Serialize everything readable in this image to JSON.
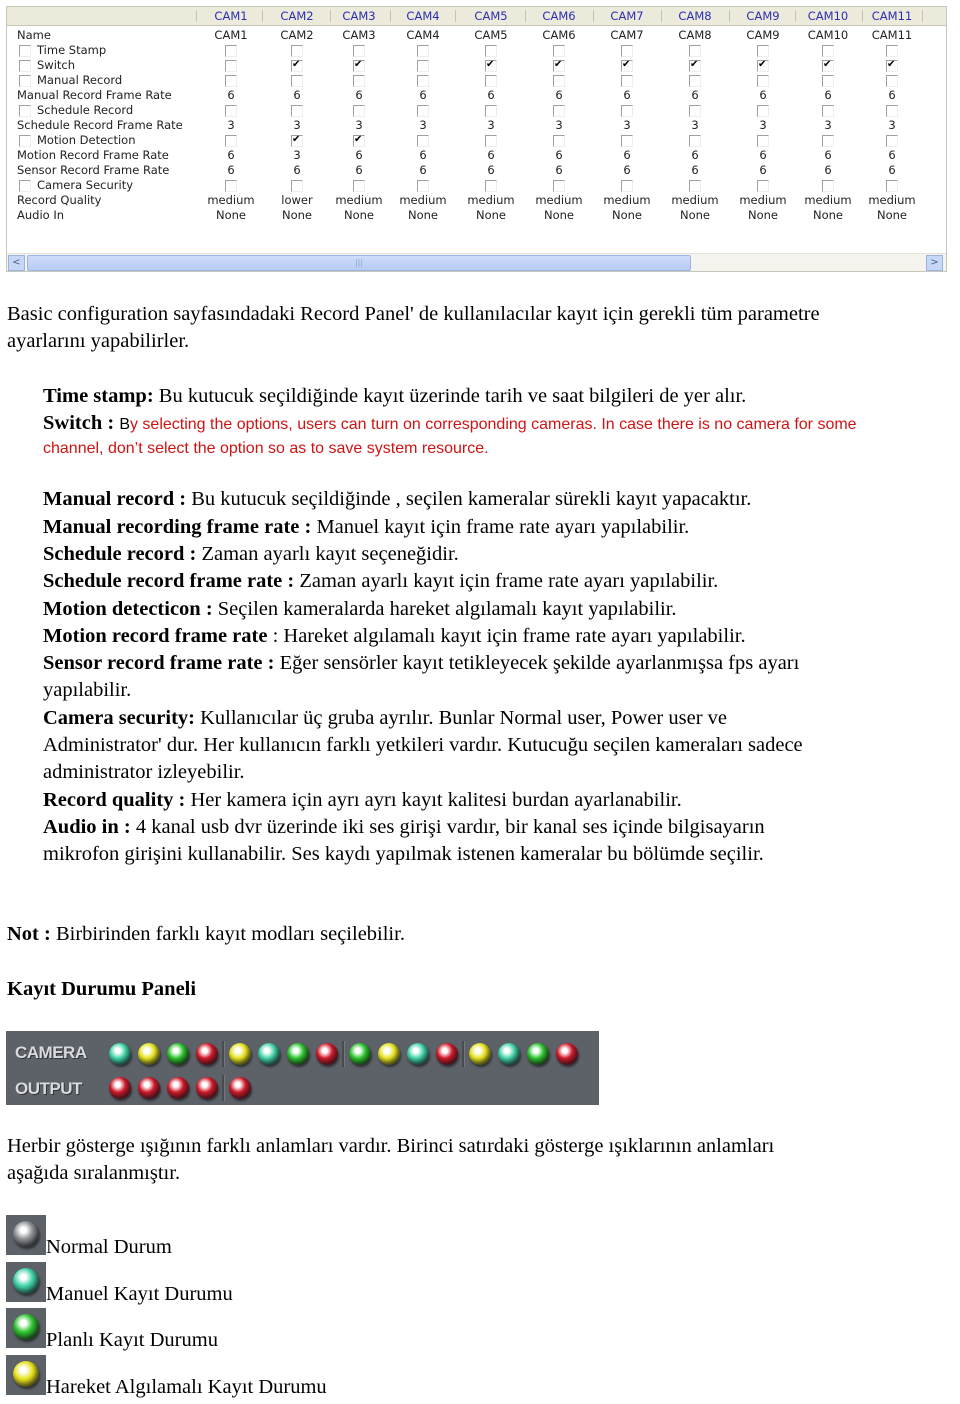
{
  "panel": {
    "columns": [
      "CAM1",
      "CAM2",
      "CAM3",
      "CAM4",
      "CAM5",
      "CAM6",
      "CAM7",
      "CAM8",
      "CAM9",
      "CAM10",
      "CAM11"
    ],
    "rows": [
      {
        "label": "Name",
        "type": "text",
        "has_checkbox": false,
        "values": [
          "CAM1",
          "CAM2",
          "CAM3",
          "CAM4",
          "CAM5",
          "CAM6",
          "CAM7",
          "CAM8",
          "CAM9",
          "CAM10",
          "CAM11"
        ]
      },
      {
        "label": "Time Stamp",
        "type": "check",
        "has_checkbox": true,
        "values": [
          false,
          false,
          false,
          false,
          false,
          false,
          false,
          false,
          false,
          false,
          false
        ]
      },
      {
        "label": "Switch",
        "type": "check",
        "has_checkbox": true,
        "values": [
          false,
          true,
          true,
          false,
          true,
          true,
          true,
          true,
          true,
          true,
          true
        ]
      },
      {
        "label": "Manual Record",
        "type": "check",
        "has_checkbox": true,
        "values": [
          false,
          false,
          false,
          false,
          false,
          false,
          false,
          false,
          false,
          false,
          false
        ]
      },
      {
        "label": "Manual Record Frame Rate",
        "type": "text",
        "has_checkbox": false,
        "values": [
          "6",
          "6",
          "6",
          "6",
          "6",
          "6",
          "6",
          "6",
          "6",
          "6",
          "6"
        ]
      },
      {
        "label": "Schedule Record",
        "type": "check",
        "has_checkbox": true,
        "values": [
          false,
          false,
          false,
          false,
          false,
          false,
          false,
          false,
          false,
          false,
          false
        ]
      },
      {
        "label": "Schedule Record Frame Rate",
        "type": "text",
        "has_checkbox": false,
        "values": [
          "3",
          "3",
          "3",
          "3",
          "3",
          "3",
          "3",
          "3",
          "3",
          "3",
          "3"
        ]
      },
      {
        "label": "Motion Detection",
        "type": "check",
        "has_checkbox": true,
        "values": [
          false,
          true,
          true,
          false,
          false,
          false,
          false,
          false,
          false,
          false,
          false
        ]
      },
      {
        "label": "Motion Record Frame Rate",
        "type": "text",
        "has_checkbox": false,
        "values": [
          "6",
          "3",
          "6",
          "6",
          "6",
          "6",
          "6",
          "6",
          "6",
          "6",
          "6"
        ]
      },
      {
        "label": "Sensor Record Frame Rate",
        "type": "text",
        "has_checkbox": false,
        "values": [
          "6",
          "6",
          "6",
          "6",
          "6",
          "6",
          "6",
          "6",
          "6",
          "6",
          "6"
        ]
      },
      {
        "label": "Camera Security",
        "type": "check",
        "has_checkbox": true,
        "values": [
          false,
          false,
          false,
          false,
          false,
          false,
          false,
          false,
          false,
          false,
          false
        ]
      },
      {
        "label": "Record Quality",
        "type": "text",
        "has_checkbox": false,
        "values": [
          "medium",
          "lower",
          "medium",
          "medium",
          "medium",
          "medium",
          "medium",
          "medium",
          "medium",
          "medium",
          "medium"
        ]
      },
      {
        "label": "Audio In",
        "type": "text",
        "has_checkbox": false,
        "values": [
          "None",
          "None",
          "None",
          "None",
          "None",
          "None",
          "None",
          "None",
          "None",
          "None",
          "None"
        ]
      }
    ],
    "scroll_left": "<",
    "scroll_right": ">"
  },
  "intro": {
    "line1": "Basic configuration   sayfasındadaki Record Panel' de kullanılacılar kayıt için gerekli tüm parametre",
    "line2": "ayarlarını yapabilirler."
  },
  "items": [
    {
      "term": "Time stamp:",
      "desc": " Bu kutucuk seçildiğinde kayıt üzerinde tarih ve saat  bilgileri de yer alır."
    },
    {
      "term": "Switch : ",
      "desc_black": "B",
      "desc_red1": "y selecting the options, users can turn on corresponding cameras. In case there is no camera for some",
      "desc_red2": "channel, don’t select the option so as to save system resource."
    },
    {
      "term": "Manual record : ",
      "desc": "Bu kutucuk seçildiğinde , seçilen kameralar  sürekli kayıt yapacaktır."
    },
    {
      "term": "Manual recording frame rate : ",
      "desc": "Manuel kayıt için frame rate ayarı yapılabilir."
    },
    {
      "term": "Schedule record : ",
      "desc": "Zaman ayarlı kayıt seçeneğidir."
    },
    {
      "term": "Schedule record frame rate : ",
      "desc": "Zaman ayarlı kayıt için frame rate ayarı yapılabilir."
    },
    {
      "term": "Motion detecticon : ",
      "desc": " Seçilen kameralarda hareket algılamalı kayıt yapılabilir."
    },
    {
      "term": "Motion record frame rate ",
      "desc": "  : Hareket algılamalı kayıt için frame rate ayarı yapılabilir."
    },
    {
      "term": "Sensor record frame rate : ",
      "desc": "Eğer sensörler kayıt tetikleyecek şekilde ayarlanmışsa fps ayarı",
      "desc2": "yapılabilir."
    },
    {
      "term": "Camera security: ",
      "desc": "Kullanıcılar üç gruba ayrılır. Bunlar Normal user,  Power user ve",
      "desc2": "Administrator' dur. Her kullanıcın farklı yetkileri vardır.  Kutucuğu seçilen kameraları sadece",
      "desc3": "administrator izleyebilir."
    },
    {
      "term": "Record quality : ",
      "desc": " Her kamera için ayrı ayrı kayıt kalitesi burdan ayarlanabilir."
    },
    {
      "term": "Audio in : ",
      "desc": "4 kanal usb dvr  üzerinde iki ses girişi vardır, bir kanal ses içinde bilgisayarın",
      "desc2": "mikrofon girişini kullanabilir. Ses kaydı yapılmak istenen kameralar bu bölümde seçilir."
    }
  ],
  "note": {
    "term": "Not : ",
    "desc": "Birbirinden farklı kayıt modları seçilebilir."
  },
  "status_heading": "Kayıt Durumu Paneli",
  "status_panel": {
    "camera_label": "CAMERA",
    "output_label": "OUTPUT",
    "camera_leds": [
      "teal",
      "yellow",
      "green",
      "red",
      "yellow",
      "teal",
      "green",
      "red",
      "green",
      "yellow",
      "teal",
      "red",
      "yellow",
      "teal",
      "green",
      "red"
    ],
    "output_leds": [
      "red",
      "red",
      "red",
      "red",
      "red"
    ],
    "colors": {
      "teal": "#3fd3a8",
      "yellow": "#e6e21c",
      "green": "#2cc42c",
      "red": "#d0182a",
      "gray": "#8a8d92"
    }
  },
  "explain": {
    "line1": "Herbir gösterge ışığının farklı anlamları vardır. Birinci satırdaki gösterge ışıklarının anlamları",
    "line2": "aşağıda sıralanmıştır."
  },
  "legend": [
    {
      "color": "gray",
      "label": "Normal Durum"
    },
    {
      "color": "teal",
      "label": "Manuel Kayıt Durumu"
    },
    {
      "color": "green",
      "label": "Planlı Kayıt Durumu"
    },
    {
      "color": "yellow",
      "label": "Hareket Algılamalı Kayıt Durumu"
    }
  ]
}
